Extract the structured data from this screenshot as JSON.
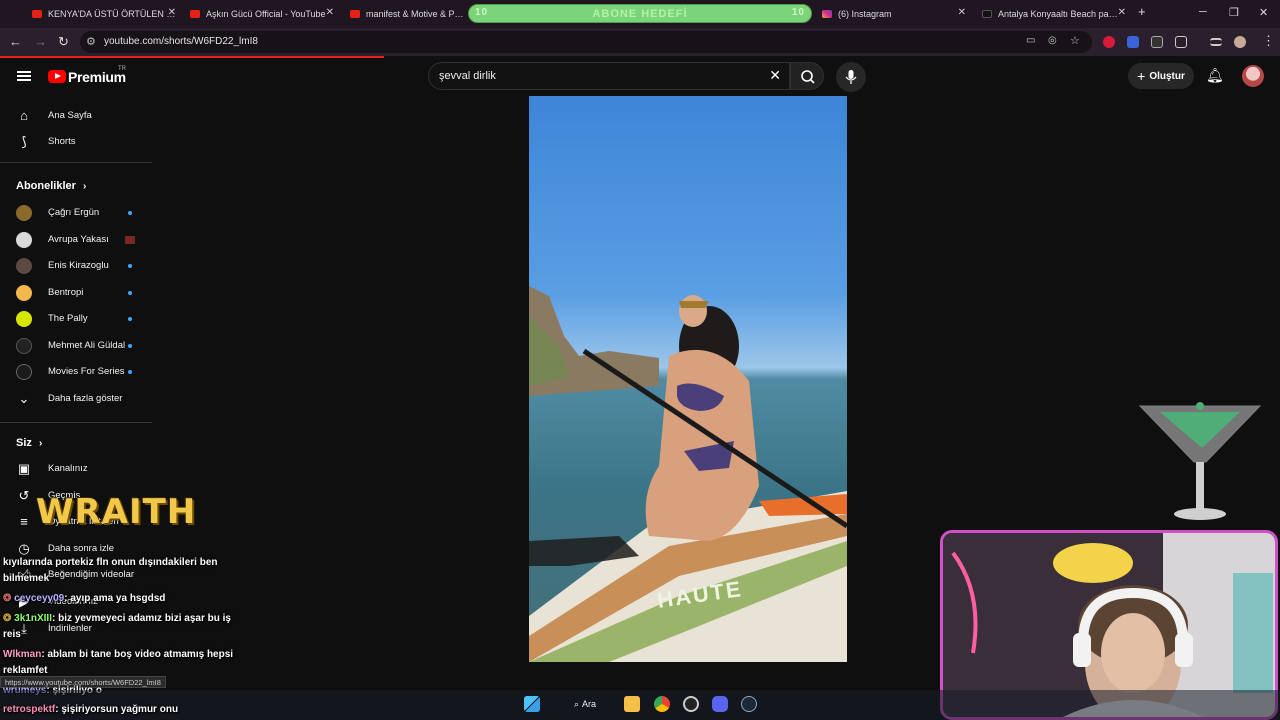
{
  "browser": {
    "tabs": [
      {
        "title": "KENYA'DA ÜSTÜ ÖRTÜLEN KOR"
      },
      {
        "title": "Aşkın Gücü Official - YouTube"
      },
      {
        "title": "manifest & Motive & Pango"
      },
      {
        "title": "(6) Instagram"
      },
      {
        "title": "Antalya Konyaaltı Beach parkta"
      }
    ],
    "new_tab": "+",
    "abone": {
      "label": "ABONE HEDEFİ",
      "left": "10",
      "right": "10"
    },
    "url": "youtube.com/shorts/W6FD22_lmI8",
    "status_link": "https://www.youtube.com/shorts/W6FD22_lmI8"
  },
  "youtube": {
    "logo": "Premium",
    "logo_sup": "TR",
    "search_value": "şevval dirlik",
    "create_label": "Oluştur"
  },
  "sidebar": {
    "main": [
      {
        "label": "Ana Sayfa",
        "icon": "home-icon"
      },
      {
        "label": "Shorts",
        "icon": "shorts-icon"
      }
    ],
    "subs_title": "Abonelikler",
    "subs": [
      {
        "label": "Çağrı Ergün",
        "color": "#8a6a2a"
      },
      {
        "label": "Avrupa Yakası",
        "color": "#d9d9d9"
      },
      {
        "label": "Enis Kirazoglu",
        "color": "#5b4a44"
      },
      {
        "label": "Bentropi",
        "color": "#f2b84b"
      },
      {
        "label": "The Pally",
        "color": "#d6e600"
      },
      {
        "label": "Mehmet Ali Güldal",
        "color": "#222222"
      },
      {
        "label": "Movies For Series",
        "color": "#1a1a1a"
      }
    ],
    "show_more": "Daha fazla göster",
    "you_title": "Siz",
    "you": [
      {
        "label": "Kanalınız",
        "icon": "channel-icon"
      },
      {
        "label": "Geçmiş",
        "icon": "history-icon"
      },
      {
        "label": "Oynatma listeleri",
        "icon": "playlist-icon"
      },
      {
        "label": "Daha sonra izle",
        "icon": "clock-icon"
      },
      {
        "label": "Beğendiğim videolar",
        "icon": "like-icon"
      },
      {
        "label": "Videolarınız",
        "icon": "video-icon"
      },
      {
        "label": "İndirilenler",
        "icon": "download-icon"
      }
    ]
  },
  "overlay": {
    "wraith": "WRAITH",
    "chat": [
      {
        "user": "",
        "msg": "kıyılarında portekiz fln onun dışındakileri ben"
      },
      {
        "user": "",
        "msg": "bilmemek"
      },
      {
        "user": "ceyceyy09",
        "msg": ": ayıp ama ya hsgdsd"
      },
      {
        "user": "3k1nXIII",
        "msg": ": biz yevmeyeci adamız bizi aşar bu iş"
      },
      {
        "user": "",
        "msg": "reis"
      },
      {
        "user": "Wlkman",
        "msg": ": ablam bi tane boş video atmamış hepsi"
      },
      {
        "user": "",
        "msg": "reklamfet"
      },
      {
        "user": "wrumeys",
        "msg": ": şişiriliyo o"
      },
      {
        "user": "retrospektf",
        "msg": ": şişiriyorsun yağmur onu"
      }
    ]
  },
  "video": {
    "board_text": "HAUTE"
  },
  "taskbar": {
    "search_label": "Ara"
  }
}
